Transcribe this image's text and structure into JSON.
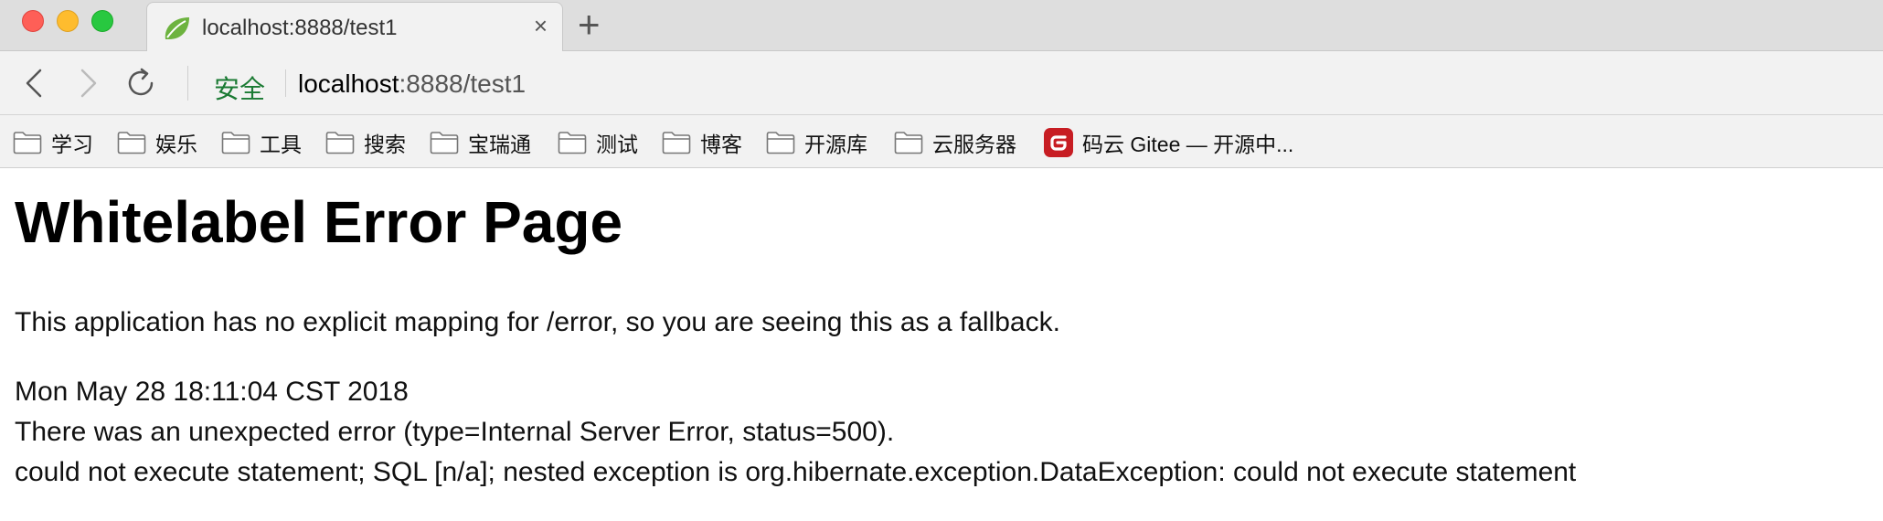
{
  "window": {
    "traffic_lights": [
      "close",
      "minimize",
      "maximize"
    ]
  },
  "tab": {
    "title": "localhost:8888/test1",
    "favicon": "spring-leaf-icon",
    "close_glyph": "×"
  },
  "new_tab_glyph": "+",
  "toolbar": {
    "secure_label": "安全",
    "url_host": "localhost",
    "url_rest": ":8888/test1"
  },
  "bookmarks": [
    {
      "label": "学习",
      "icon": "folder-icon"
    },
    {
      "label": "娱乐",
      "icon": "folder-icon"
    },
    {
      "label": "工具",
      "icon": "folder-icon"
    },
    {
      "label": "搜索",
      "icon": "folder-icon"
    },
    {
      "label": "宝瑞通",
      "icon": "folder-icon"
    },
    {
      "label": "测试",
      "icon": "folder-icon"
    },
    {
      "label": "博客",
      "icon": "folder-icon"
    },
    {
      "label": "开源库",
      "icon": "folder-icon"
    },
    {
      "label": "云服务器",
      "icon": "folder-icon"
    },
    {
      "label": "码云 Gitee — 开源中...",
      "icon": "gitee-icon"
    }
  ],
  "page": {
    "heading": "Whitelabel Error Page",
    "intro": "This application has no explicit mapping for /error, so you are seeing this as a fallback.",
    "timestamp": "Mon May 28 18:11:04 CST 2018",
    "error_summary": "There was an unexpected error (type=Internal Server Error, status=500).",
    "error_detail": "could not execute statement; SQL [n/a]; nested exception is org.hibernate.exception.DataException: could not execute statement"
  },
  "colors": {
    "secure_green": "#1a7a33",
    "spring_green": "#6db33f",
    "gitee_red": "#c71d23"
  }
}
